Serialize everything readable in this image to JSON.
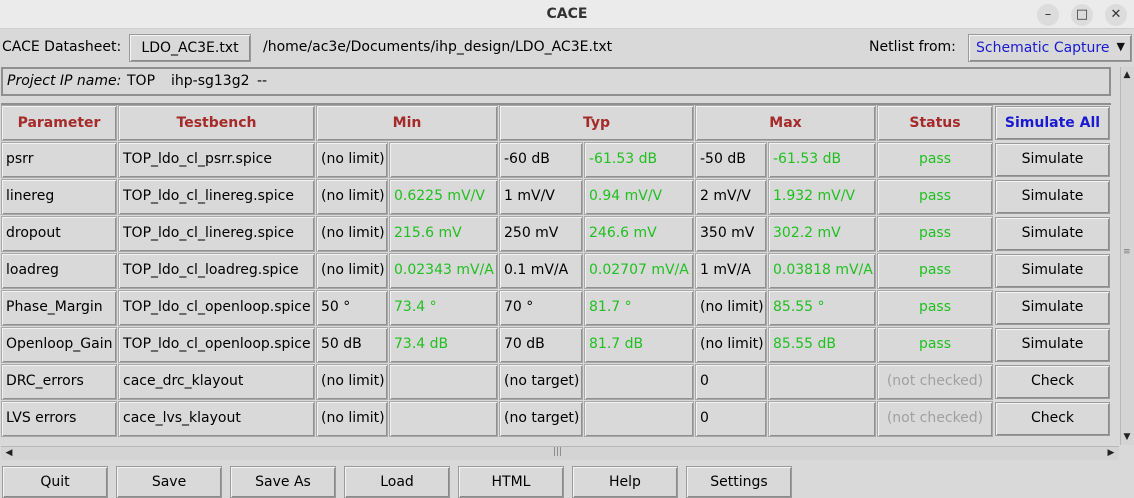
{
  "window": {
    "title": "CACE"
  },
  "topbar": {
    "datasheet_label": "CACE Datasheet:",
    "datasheet_button": "LDO_AC3E.txt",
    "path": "/home/ac3e/Documents/ihp_design/LDO_AC3E.txt",
    "netlist_label": "Netlist from:",
    "netlist_value": "Schematic Capture"
  },
  "project": {
    "label": "Project IP name:",
    "name": "TOP",
    "pdk": "ihp-sg13g2",
    "extra": "--"
  },
  "table": {
    "headers": {
      "parameter": "Parameter",
      "testbench": "Testbench",
      "min": "Min",
      "typ": "Typ",
      "max": "Max",
      "status": "Status",
      "simulate_all": "Simulate All"
    },
    "rows": [
      {
        "parameter": "psrr",
        "testbench": "TOP_ldo_cl_psrr.spice",
        "min_spec": "(no limit)",
        "min_value": "",
        "typ_spec": "-60 dB",
        "typ_value": "-61.53 dB",
        "max_spec": "-50 dB",
        "max_value": "-61.53 dB",
        "status": "pass",
        "action": "Simulate"
      },
      {
        "parameter": "linereg",
        "testbench": "TOP_ldo_cl_linereg.spice",
        "min_spec": "(no limit)",
        "min_value": "0.6225 mV/V",
        "typ_spec": "1 mV/V",
        "typ_value": "0.94 mV/V",
        "max_spec": "2 mV/V",
        "max_value": "1.932 mV/V",
        "status": "pass",
        "action": "Simulate"
      },
      {
        "parameter": "dropout",
        "testbench": "TOP_ldo_cl_linereg.spice",
        "min_spec": "(no limit)",
        "min_value": "215.6 mV",
        "typ_spec": "250 mV",
        "typ_value": "246.6 mV",
        "max_spec": "350 mV",
        "max_value": "302.2 mV",
        "status": "pass",
        "action": "Simulate"
      },
      {
        "parameter": "loadreg",
        "testbench": "TOP_ldo_cl_loadreg.spice",
        "min_spec": "(no limit)",
        "min_value": "0.02343 mV/A",
        "typ_spec": "0.1 mV/A",
        "typ_value": "0.02707 mV/A",
        "max_spec": "1 mV/A",
        "max_value": "0.03818 mV/A",
        "status": "pass",
        "action": "Simulate"
      },
      {
        "parameter": "Phase_Margin",
        "testbench": "TOP_ldo_cl_openloop.spice",
        "min_spec": "50 °",
        "min_value": "73.4 °",
        "typ_spec": "70 °",
        "typ_value": "81.7 °",
        "max_spec": "(no limit)",
        "max_value": "85.55 °",
        "status": "pass",
        "action": "Simulate"
      },
      {
        "parameter": "Openloop_Gain",
        "testbench": "TOP_ldo_cl_openloop.spice",
        "min_spec": "50 dB",
        "min_value": "73.4 dB",
        "typ_spec": "70 dB",
        "typ_value": "81.7 dB",
        "max_spec": "(no limit)",
        "max_value": "85.55 dB",
        "status": "pass",
        "action": "Simulate"
      },
      {
        "parameter": "DRC_errors",
        "testbench": "cace_drc_klayout",
        "min_spec": "(no limit)",
        "min_value": "",
        "typ_spec": "(no target)",
        "typ_value": "",
        "max_spec": "0",
        "max_value": "",
        "status": "(not checked)",
        "action": "Check"
      },
      {
        "parameter": "LVS errors",
        "testbench": "cace_lvs_klayout",
        "min_spec": "(no limit)",
        "min_value": "",
        "typ_spec": "(no target)",
        "typ_value": "",
        "max_spec": "0",
        "max_value": "",
        "status": "(not checked)",
        "action": "Check"
      }
    ]
  },
  "bottombar": {
    "buttons": [
      "Quit",
      "Save",
      "Save As",
      "Load",
      "HTML",
      "Help",
      "Settings"
    ]
  },
  "colors": {
    "header_red": "#a52a2a",
    "accent_blue": "#1a1ad0",
    "pass_green": "#20c020",
    "muted_grey": "#a0a0a0"
  }
}
